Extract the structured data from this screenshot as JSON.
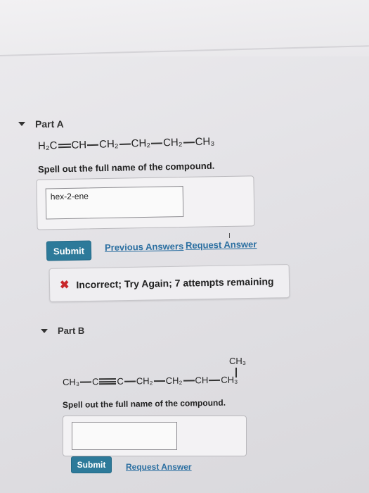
{
  "part_a": {
    "title": "Part A",
    "formula": [
      "H₂C",
      "CH",
      "CH₂",
      "CH₂",
      "CH₂",
      "CH₃"
    ],
    "prompt": "Spell out the full name of the compound.",
    "answer_value": "hex-2-ene",
    "submit_label": "Submit",
    "previous_answers_label": "Previous Answers",
    "request_answer_label": "Request Answer",
    "feedback_text": "Incorrect; Try Again; 7 attempts remaining",
    "feedback_icon": "x-icon"
  },
  "part_b": {
    "title": "Part B",
    "formula": [
      "CH₃",
      "C",
      "C",
      "CH₂",
      "CH₂",
      "CH",
      "CH₃"
    ],
    "branch": "CH₃",
    "prompt": "Spell out the full name of the compound.",
    "answer_value": "",
    "submit_label": "Submit",
    "request_answer_label": "Request Answer"
  },
  "colors": {
    "button": "#2d7a9a",
    "link": "#2b6fa1",
    "error": "#c8262a"
  }
}
